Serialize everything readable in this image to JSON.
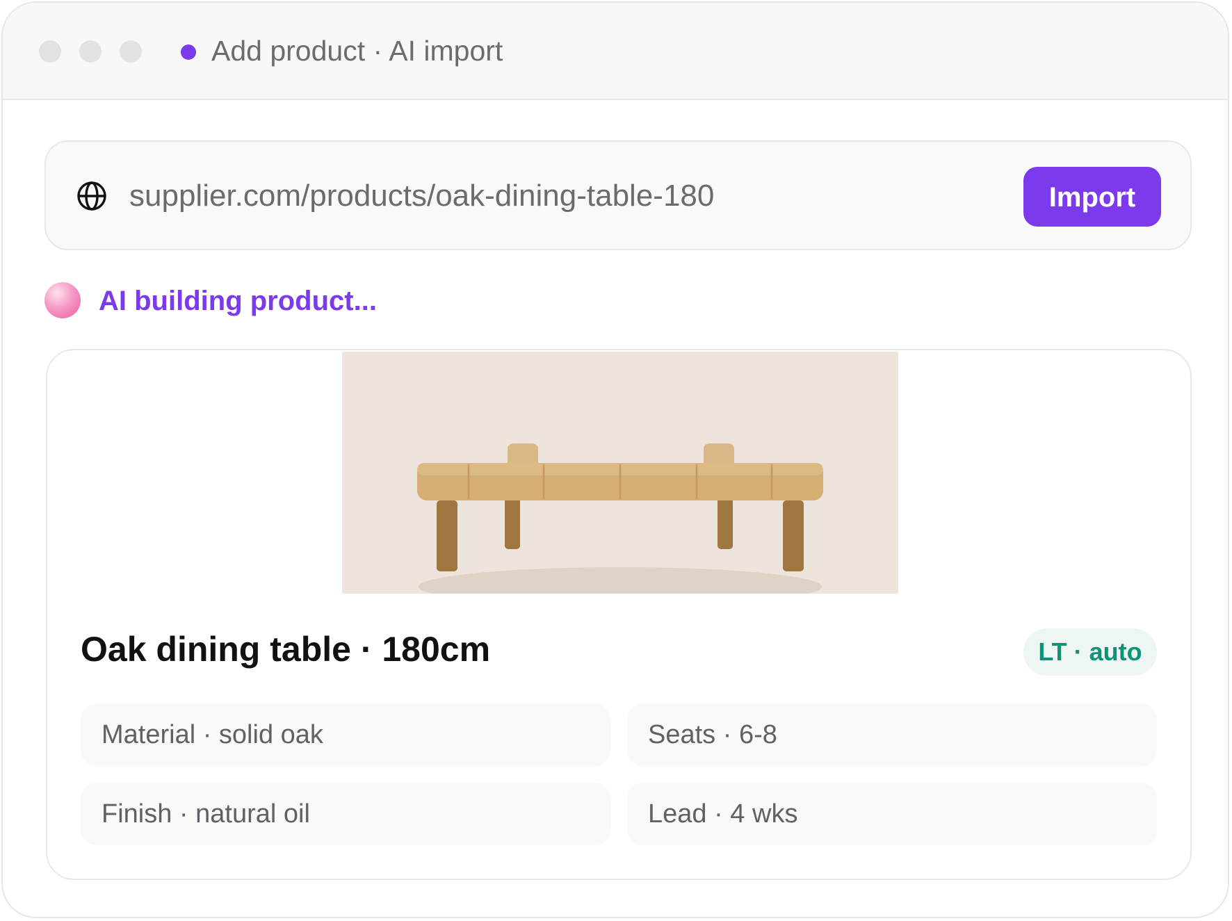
{
  "window": {
    "title": "Add product · AI import",
    "status_color": "#7c3aed"
  },
  "import_bar": {
    "icon": "globe-icon",
    "url_value": "supplier.com/products/oak-dining-table-180",
    "button_label": "Import",
    "button_color": "#7c3aed"
  },
  "ai": {
    "status_text": "AI building product..."
  },
  "product": {
    "image_alt": "oak dining table",
    "title": "Oak dining table · 180cm",
    "badge": "LT · auto",
    "attributes": [
      {
        "text": "Material · solid oak"
      },
      {
        "text": "Seats · 6-8"
      },
      {
        "text": "Finish · natural oil"
      },
      {
        "text": "Lead · 4 wks"
      }
    ]
  }
}
